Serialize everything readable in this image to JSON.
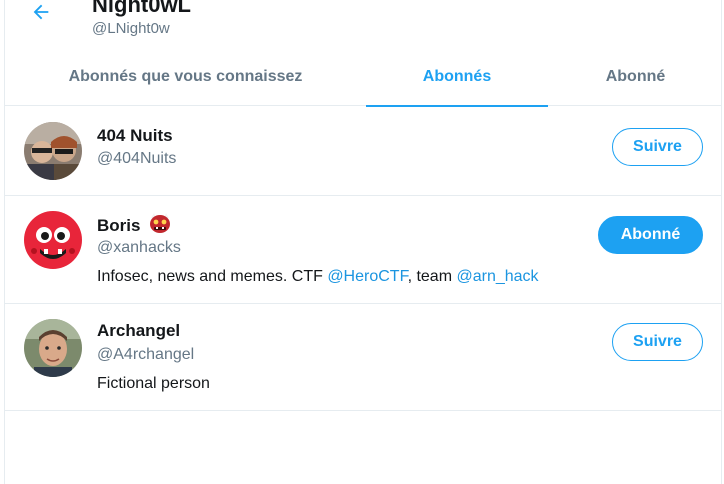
{
  "header": {
    "name": "Night0wL",
    "handle": "@LNight0w"
  },
  "tabs": [
    {
      "label": "Abonnés que vous connaissez",
      "active": false
    },
    {
      "label": "Abonnés",
      "active": true
    },
    {
      "label": "Abonné",
      "active": false
    }
  ],
  "users": [
    {
      "name": "404 Nuits",
      "handle": "@404Nuits",
      "button": "Suivre"
    },
    {
      "name": "Boris",
      "handle": "@xanhacks",
      "bio_text_1": "Infosec, news and memes. CTF ",
      "bio_link_1": "@HeroCTF",
      "bio_text_2": ", team ",
      "bio_link_2": "@arn_hack",
      "button": "Abonné",
      "emoji": "ogre-emoji"
    },
    {
      "name": "Archangel",
      "handle": "@A4rchangel",
      "bio": "Fictional person",
      "button": "Suivre"
    }
  ],
  "colors": {
    "accent": "#1da1f2",
    "text": "#14171a",
    "muted": "#657786",
    "border": "#e6ecf0"
  },
  "icons": {
    "back": "arrow-left-icon"
  }
}
